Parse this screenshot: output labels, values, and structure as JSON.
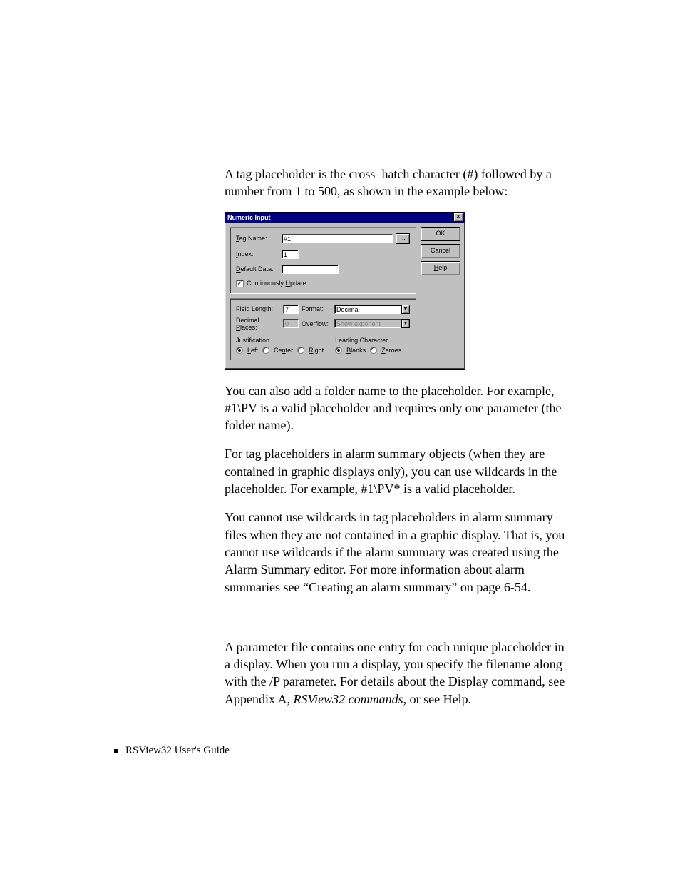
{
  "intro": "A tag placeholder is the cross–hatch character (#) followed by a number from 1 to 500, as shown in the example below:",
  "dialog": {
    "title": "Numeric Input",
    "close_glyph": "×",
    "labels": {
      "tag_name": "Tag Name:",
      "index": "Index:",
      "default_data": "Default Data:",
      "continuously_update": "Continuously Update",
      "field_length": "Field Length:",
      "format": "Format:",
      "decimal_places": "Decimal Places:",
      "overflow": "Overflow:",
      "justification": "Justification",
      "leading_character": "Leading Character"
    },
    "values": {
      "tag_name": "#1",
      "index": "1",
      "default_data": "",
      "continuously_update_checked": true,
      "field_length": "7",
      "format": "Decimal",
      "decimal_places": "0",
      "overflow": "Show exponent"
    },
    "justification": {
      "left": "Left",
      "center": "Center",
      "right": "Right",
      "selected": "left"
    },
    "leading": {
      "blanks": "Blanks",
      "zeroes": "Zeroes",
      "selected": "blanks"
    },
    "buttons": {
      "ok": "OK",
      "cancel": "Cancel",
      "help": "Help",
      "browse": "..."
    },
    "dropdown_glyph": "▼"
  },
  "para2": "You can also add a folder name to the placeholder. For example, #1\\PV is a valid placeholder and requires only one parameter (the folder name).",
  "para3": "For tag placeholders in alarm summary objects (when they are contained in graphic displays only), you can use wildcards in the placeholder. For example, #1\\PV* is a valid placeholder.",
  "para4": "You cannot use wildcards in tag placeholders in alarm summary files when they are not contained in a graphic display. That is, you cannot use wildcards if the alarm summary was created using the Alarm Summary editor. For more information about alarm summaries see “Creating an alarm summary” on page 6-54.",
  "para5_pre": "A parameter file contains one entry for each unique placeholder in a display. When you run a display, you specify the filename along with the /P parameter. For details about the Display command, see Appendix A, ",
  "para5_italic": "RSView32 commands",
  "para5_post": ", or see Help.",
  "footer": "RSView32  User's Guide"
}
